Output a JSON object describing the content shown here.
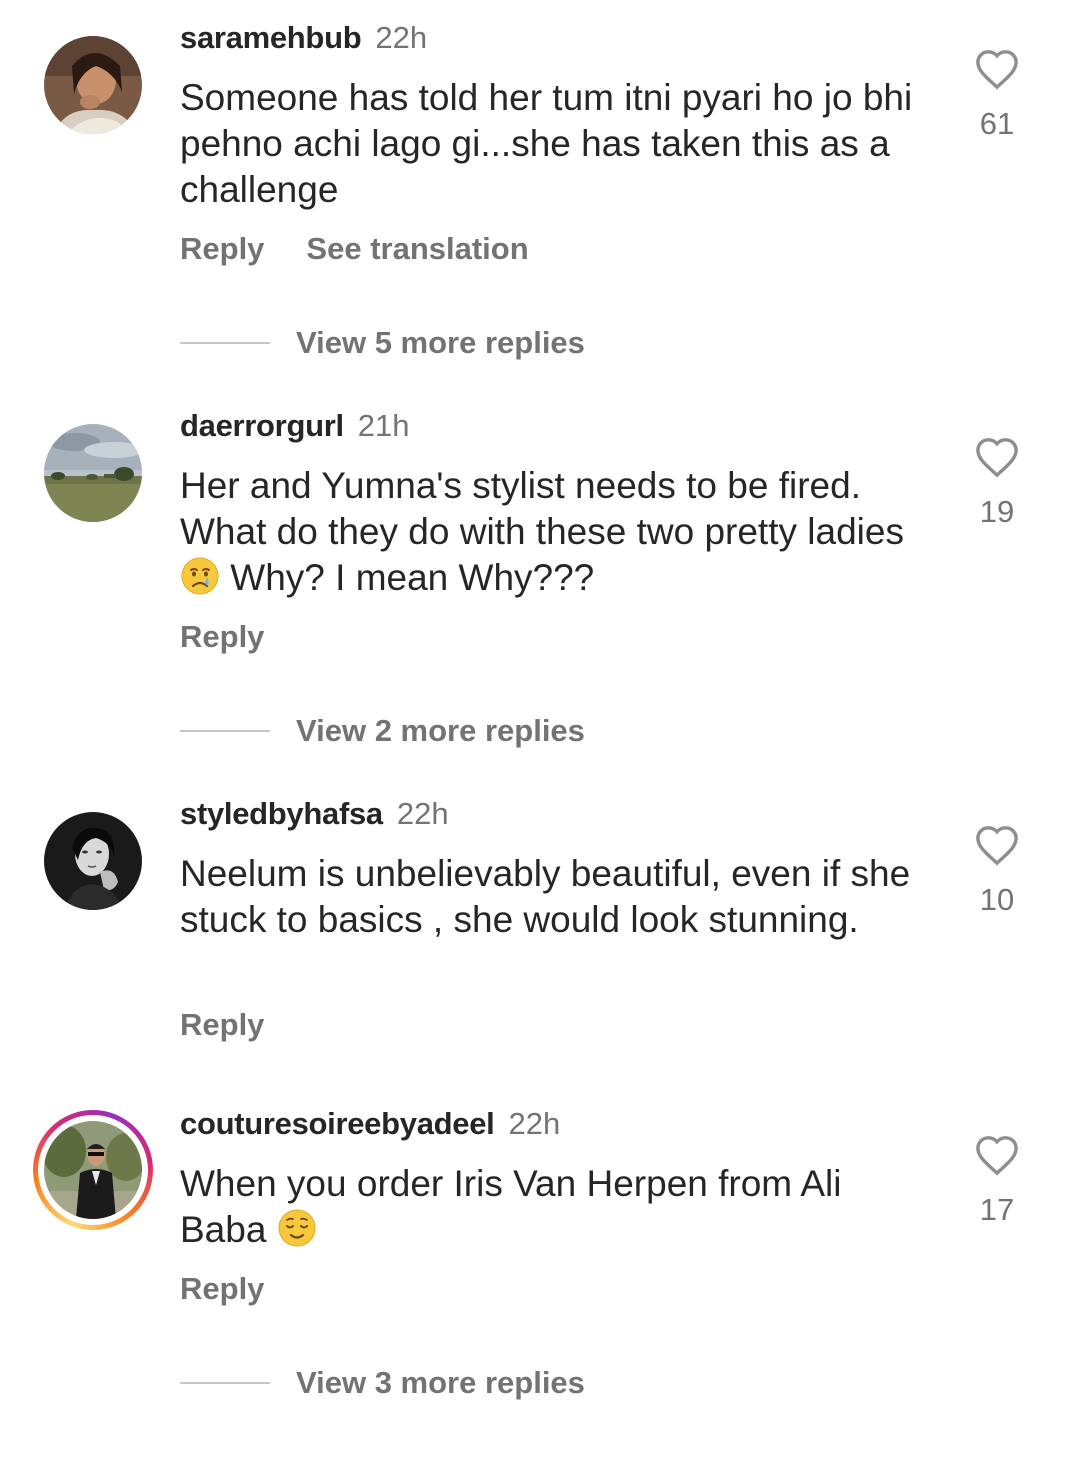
{
  "comments": [
    {
      "username": "saramehbub",
      "time": "22h",
      "text": "Someone has told her tum itni pyari ho jo bhi pehno achi lago gi...she has taken this as a challenge",
      "likes": "61",
      "reply_label": "Reply",
      "translation_label": "See translation",
      "more_replies": "View 5 more replies",
      "avatar_icon": "woman-portrait-avatar"
    },
    {
      "username": "daerrorgurl",
      "time": "21h",
      "text_before_emoji": "Her and Yumna's stylist needs to be fired. What do they do with these two pretty ladies",
      "text_after_emoji": " Why? I mean Why???",
      "emoji": "crying-face-emoji",
      "likes": "19",
      "reply_label": "Reply",
      "more_replies": "View 2 more replies",
      "avatar_icon": "landscape-field-avatar"
    },
    {
      "username": "styledbyhafsa",
      "time": "22h",
      "text": "Neelum is unbelievably beautiful, even if she stuck to basics , she would look stunning.",
      "likes": "10",
      "reply_label": "Reply",
      "avatar_icon": "monochrome-portrait-avatar"
    },
    {
      "username": "couturesoireebyadeel",
      "time": "22h",
      "text_before_emoji": "When you order Iris Van Herpen from Ali Baba ",
      "emoji": "relieved-face-emoji",
      "likes": "17",
      "reply_label": "Reply",
      "more_replies": "View 3 more replies",
      "avatar_icon": "man-in-suit-avatar-with-story-ring"
    }
  ],
  "colors": {
    "primary_text": "#262626",
    "secondary_text": "#737373",
    "divider": "#c7c7c7",
    "story_ring": [
      "#feda75",
      "#fa7e1e",
      "#d62976",
      "#962fbf"
    ]
  }
}
